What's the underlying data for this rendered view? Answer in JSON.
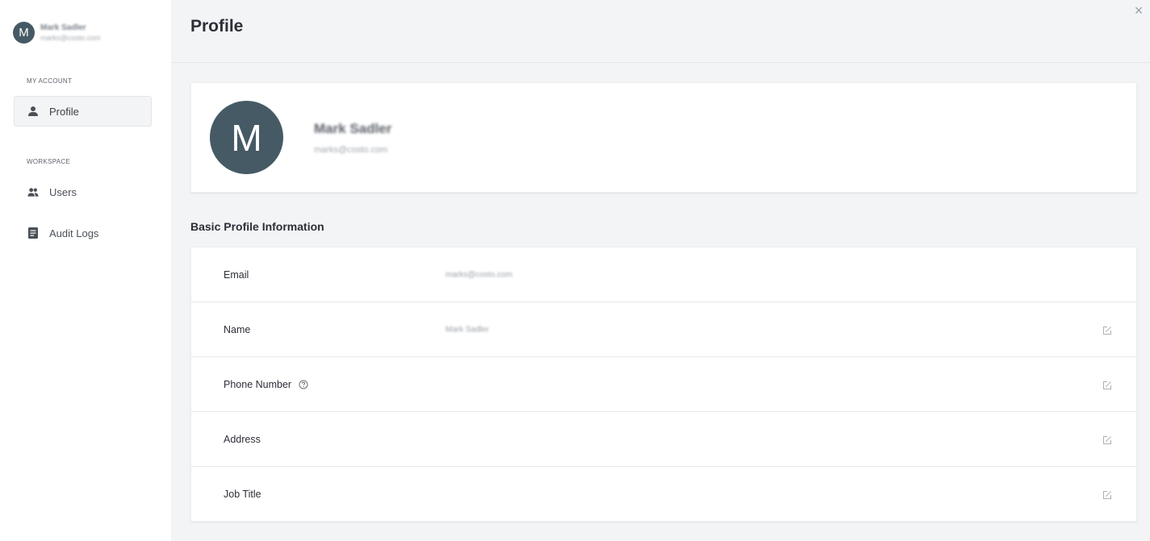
{
  "sidebar": {
    "user": {
      "initial": "M",
      "name": "Mark Sadler",
      "email": "marks@costo.com"
    },
    "sections": [
      {
        "label": "MY ACCOUNT"
      },
      {
        "label": "WORKSPACE"
      }
    ],
    "items": [
      {
        "label": "Profile",
        "icon": "person-icon",
        "active": true
      },
      {
        "label": "Users",
        "icon": "users-icon",
        "active": false
      },
      {
        "label": "Audit Logs",
        "icon": "document-icon",
        "active": false
      }
    ]
  },
  "header": {
    "title": "Profile",
    "close_label": "×"
  },
  "profile_card": {
    "initial": "M",
    "name": "Mark Sadler",
    "email": "marks@costo.com"
  },
  "basic_info": {
    "title": "Basic Profile Information",
    "rows": [
      {
        "label": "Email",
        "value": "marks@costo.com",
        "editable": false,
        "help": false
      },
      {
        "label": "Name",
        "value": "Mark Sadler",
        "editable": true,
        "help": false
      },
      {
        "label": "Phone Number",
        "value": "",
        "editable": true,
        "help": true
      },
      {
        "label": "Address",
        "value": "",
        "editable": true,
        "help": false
      },
      {
        "label": "Job Title",
        "value": "",
        "editable": true,
        "help": false
      }
    ]
  },
  "colors": {
    "avatar": "#455a64",
    "page_bg": "#f3f4f6",
    "card_bg": "#ffffff"
  }
}
